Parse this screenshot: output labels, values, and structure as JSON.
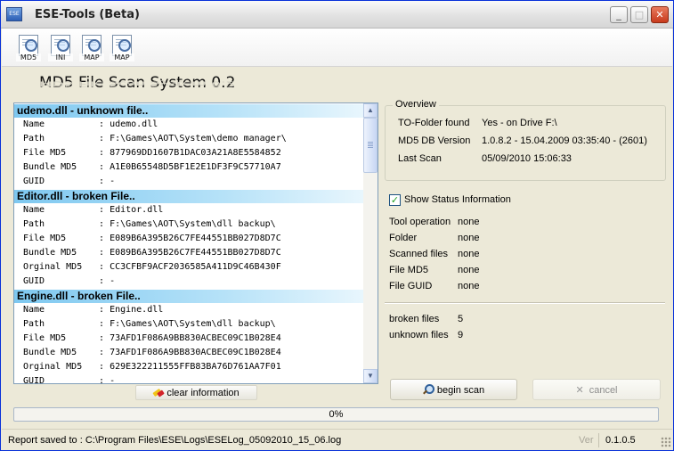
{
  "window": {
    "title": "ESE-Tools (Beta)",
    "app_icon_text": "ESE",
    "minimize": "_",
    "maximize": "□",
    "close": "✕"
  },
  "toolbar": {
    "buttons": [
      {
        "label": "MD5",
        "icon": "md5-scan-icon"
      },
      {
        "label": "INI",
        "icon": "ini-scan-icon"
      },
      {
        "label": "MAP",
        "icon": "map-scan-icon"
      },
      {
        "label": "MAP",
        "icon": "map-scan-icon"
      }
    ]
  },
  "heading": "MD5 File Scan System 0.2",
  "entries": [
    {
      "header": "udemo.dll - unknown file..",
      "rows": [
        {
          "key": "Name",
          "value": "udemo.dll"
        },
        {
          "key": "Path",
          "value": "F:\\Games\\AOT\\System\\demo manager\\"
        },
        {
          "key": "File MD5",
          "value": "877969DD1607B1DAC03A21A8E5584852"
        },
        {
          "key": "Bundle MD5",
          "value": "A1E0B65548D5BF1E2E1DF3F9C57710A7"
        },
        {
          "key": "GUID",
          "value": "-"
        }
      ]
    },
    {
      "header": "Editor.dll - broken File..",
      "rows": [
        {
          "key": "Name",
          "value": "Editor.dll"
        },
        {
          "key": "Path",
          "value": "F:\\Games\\AOT\\System\\dll backup\\"
        },
        {
          "key": "File MD5",
          "value": "E089B6A395B26C7FE44551BB027D8D7C"
        },
        {
          "key": "Bundle MD5",
          "value": "E089B6A395B26C7FE44551BB027D8D7C"
        },
        {
          "key": "Orginal MD5",
          "value": "CC3CFBF9ACF2036585A411D9C46B430F"
        },
        {
          "key": "GUID",
          "value": "-"
        }
      ]
    },
    {
      "header": "Engine.dll - broken File..",
      "rows": [
        {
          "key": "Name",
          "value": "Engine.dll"
        },
        {
          "key": "Path",
          "value": "F:\\Games\\AOT\\System\\dll backup\\"
        },
        {
          "key": "File MD5",
          "value": "73AFD1F086A9BB830ACBEC09C1B028E4"
        },
        {
          "key": "Bundle MD5",
          "value": "73AFD1F086A9BB830ACBEC09C1B028E4"
        },
        {
          "key": "Orginal MD5",
          "value": "629E322211555FFB83BA76D761AA7F01"
        },
        {
          "key": "GUID",
          "value": "-"
        }
      ]
    }
  ],
  "list": {
    "separator": ":",
    "clear_button": "clear information"
  },
  "overview": {
    "title": "Overview",
    "items": [
      {
        "label": "TO-Folder found",
        "value": "Yes - on Drive F:\\"
      },
      {
        "label": "MD5 DB Version",
        "value": "1.0.8.2 - 15.04.2009 03:35:40 - (2601)"
      },
      {
        "label": "Last Scan",
        "value": "05/09/2010 15:06:33"
      }
    ]
  },
  "status_info": {
    "checkbox_label": "Show Status Information",
    "checked": true,
    "check_mark": "✓",
    "items": [
      {
        "label": "Tool operation",
        "value": "none"
      },
      {
        "label": "Folder",
        "value": "none"
      },
      {
        "label": "Scanned files",
        "value": "none"
      },
      {
        "label": "File MD5",
        "value": "none"
      },
      {
        "label": "File GUID",
        "value": "none"
      }
    ]
  },
  "counts": [
    {
      "label": "broken files",
      "value": "5"
    },
    {
      "label": "unknown files",
      "value": "9"
    }
  ],
  "actions": {
    "begin": "begin scan",
    "cancel": "cancel",
    "cancel_icon": "✕"
  },
  "progress": {
    "value": 0,
    "text": "0%"
  },
  "statusbar": {
    "report": "Report saved to : C:\\Program Files\\ESE\\Logs\\ESELog_05092010_15_06.log",
    "version_label": "Ver",
    "version": "0.1.0.5"
  },
  "colors": {
    "entry_header": "#7ec8f0",
    "window_bg": "#ece9d8",
    "progress_fill": "#7fbf5f"
  }
}
